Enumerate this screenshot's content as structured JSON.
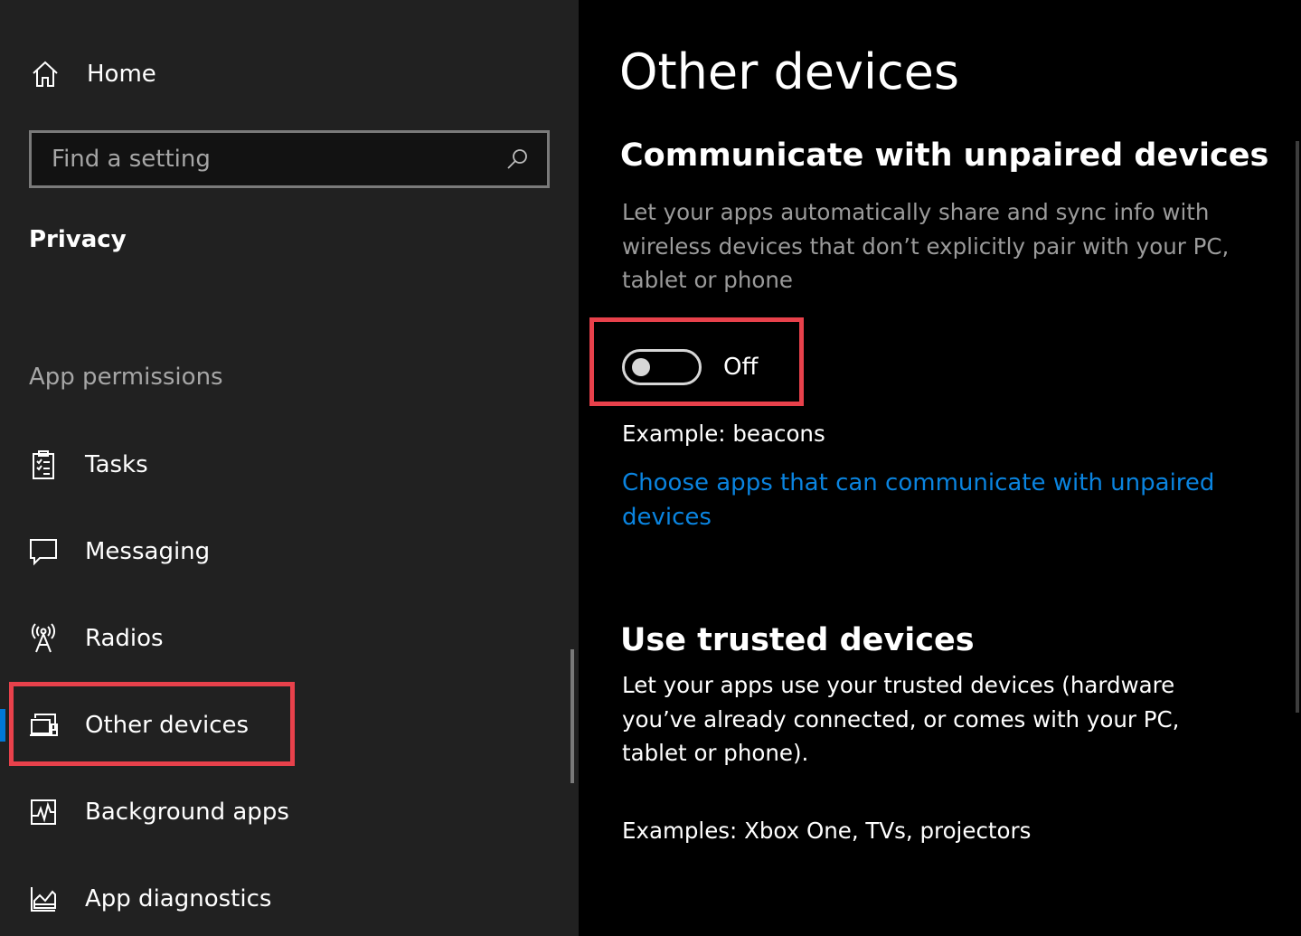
{
  "sidebar": {
    "home_label": "Home",
    "search_placeholder": "Find a setting",
    "section_title": "Privacy",
    "group_title": "App permissions",
    "items": [
      {
        "label": "Tasks",
        "icon": "tasks-icon"
      },
      {
        "label": "Messaging",
        "icon": "message-icon"
      },
      {
        "label": "Radios",
        "icon": "radio-tower-icon"
      },
      {
        "label": "Other devices",
        "icon": "devices-icon",
        "selected": true
      },
      {
        "label": "Background apps",
        "icon": "background-apps-icon"
      },
      {
        "label": "App diagnostics",
        "icon": "diagnostics-icon"
      }
    ]
  },
  "main": {
    "title": "Other devices",
    "unpaired": {
      "heading": "Communicate with unpaired devices",
      "description": "Let your apps automatically share and sync info with wireless devices that don’t explicitly pair with your PC, tablet or phone",
      "toggle_state": "Off",
      "toggle_on": false,
      "example": "Example: beacons",
      "link": "Choose apps that can communicate with unpaired devices"
    },
    "trusted": {
      "heading": "Use trusted devices",
      "description": "Let your apps use your trusted devices (hardware you’ve already connected, or comes with your PC, tablet or phone).",
      "examples": "Examples: Xbox One, TVs, projectors"
    }
  },
  "colors": {
    "sidebar_bg": "#212121",
    "main_bg": "#000000",
    "accent": "#0078d7",
    "link": "#0a84e0",
    "highlight": "#e8414b"
  }
}
